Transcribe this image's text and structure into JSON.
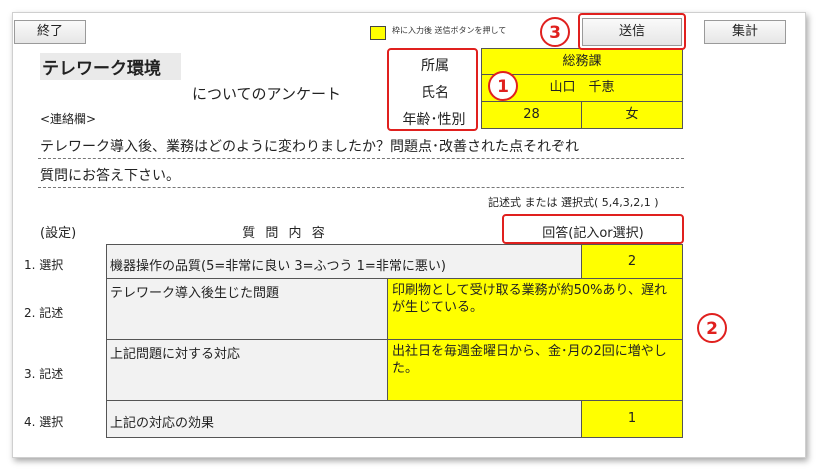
{
  "toolbar": {
    "end_label": "終了",
    "notice_text": "枠に入力後 送信ボタンを押して",
    "send_label": "送信",
    "tally_label": "集計"
  },
  "header": {
    "title": "テレワーク環境",
    "subtitle": "についてのアンケート",
    "contact_label": "<連絡欄>"
  },
  "profile": {
    "dept_label": "所属",
    "dept_value": "総務課",
    "name_label": "氏名",
    "name_value": "山口　千恵",
    "agegender_label": "年齢･性別",
    "age_value": "28",
    "gender_value": "女"
  },
  "intro": {
    "line1": "テレワーク導入後、業務はどのように変わりましたか？問題点･改善された点それぞれ",
    "line2": "質問にお答え下さい。",
    "hint": "記述式 または 選択式( 5,4,3,2,1 )"
  },
  "table": {
    "setting_header": "(設定)",
    "question_header": "質 問 内 容",
    "answer_header": "回答(記入or選択)",
    "rows": [
      {
        "setting": "1. 選択",
        "question": "機器操作の品質(5=非常に良い 3=ふつう 1=非常に悪い)",
        "answer": "2"
      },
      {
        "setting": "2. 記述",
        "question": "テレワーク導入後生じた問題",
        "answer": "印刷物として受け取る業務が約50%あり、遅れが生じている。"
      },
      {
        "setting": "3. 記述",
        "question": "上記問題に対する対応",
        "answer": "出社日を毎週金曜日から、金･月の2回に増やした。"
      },
      {
        "setting": "4. 選択",
        "question": "上記の対応の効果",
        "answer": "1"
      }
    ]
  },
  "annotations": {
    "badge1": "1",
    "badge2": "2",
    "badge3": "3"
  },
  "colors": {
    "input_fill": "#ffff00",
    "annotation_red": "#e0201e"
  }
}
